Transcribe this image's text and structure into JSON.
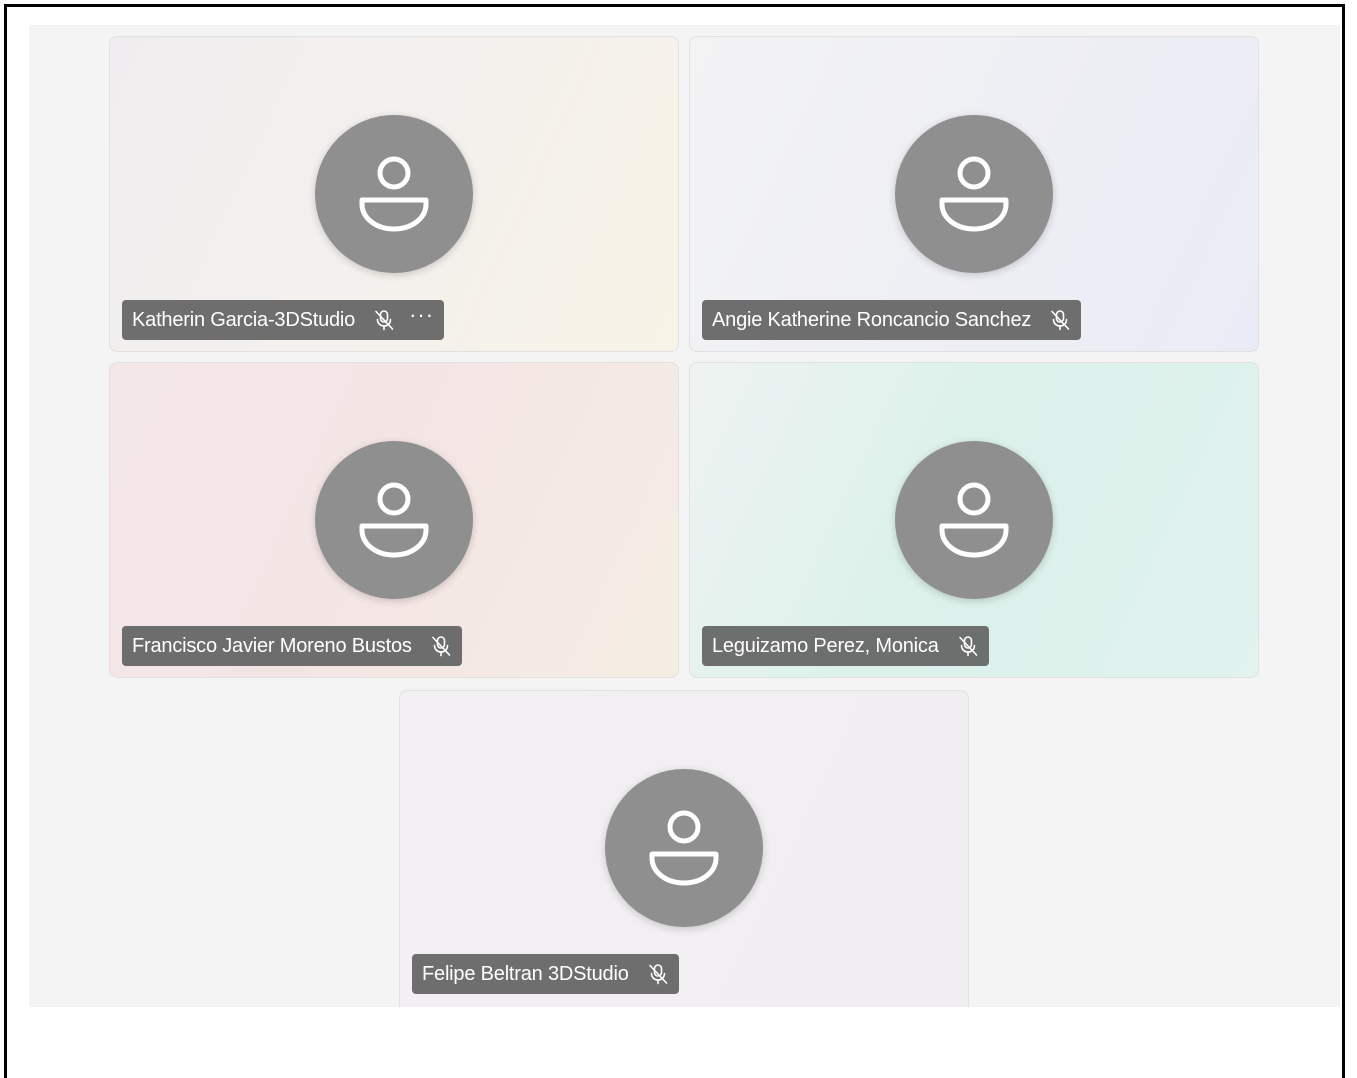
{
  "participants": [
    {
      "name": "Katherin Garcia-3DStudio",
      "muted": true,
      "has_more_menu": true
    },
    {
      "name": "Angie Katherine Roncancio Sanchez",
      "muted": true,
      "has_more_menu": false
    },
    {
      "name": "Francisco Javier Moreno Bustos",
      "muted": true,
      "has_more_menu": false
    },
    {
      "name": "Leguizamo Perez, Monica",
      "muted": true,
      "has_more_menu": false
    },
    {
      "name": "Felipe Beltran 3DStudio",
      "muted": true,
      "has_more_menu": false
    }
  ],
  "more_glyph": "···",
  "colors": {
    "avatar": "#8f8f8f",
    "name_plate": "#686868",
    "stage": "#f4f4f4"
  },
  "icons": {
    "avatar": "person-icon",
    "mic": "mic-off-icon",
    "more": "more-options-icon"
  }
}
